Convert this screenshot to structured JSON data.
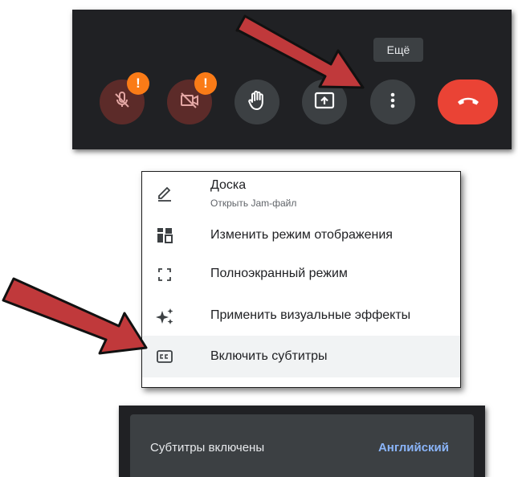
{
  "controls": {
    "buttons": [
      {
        "name": "microphone-off-button",
        "icon": "mic-off-icon",
        "badge": "!"
      },
      {
        "name": "camera-off-button",
        "icon": "camera-off-icon",
        "badge": "!"
      },
      {
        "name": "raise-hand-button",
        "icon": "hand-icon"
      },
      {
        "name": "present-button",
        "icon": "present-screen-icon"
      },
      {
        "name": "more-options-button",
        "icon": "more-vert-icon"
      },
      {
        "name": "end-call-button",
        "icon": "phone-hangup-icon"
      }
    ],
    "more_tooltip": "Ещё",
    "colors": {
      "bar": "#202124",
      "muted": "#5c2b29",
      "grey": "#3c4043",
      "end": "#ea4335",
      "badge": "#fa7b17"
    }
  },
  "menu": {
    "items": [
      {
        "label": "Доска",
        "sublabel": "Открыть Jam-файл",
        "icon": "pen-icon"
      },
      {
        "label": "Изменить режим отображения",
        "icon": "layout-icon"
      },
      {
        "label": "Полноэкранный режим",
        "icon": "fullscreen-icon"
      },
      {
        "label": "Применить визуальные эффекты",
        "icon": "sparkle-icon"
      },
      {
        "label": "Включить субтитры",
        "icon": "closed-captions-icon",
        "highlighted": true
      }
    ]
  },
  "captions": {
    "status": "Субтитры включены",
    "language": "Английский",
    "colors": {
      "link": "#8ab4f8"
    }
  },
  "annotations": {
    "arrow_color": "#c0393b"
  }
}
